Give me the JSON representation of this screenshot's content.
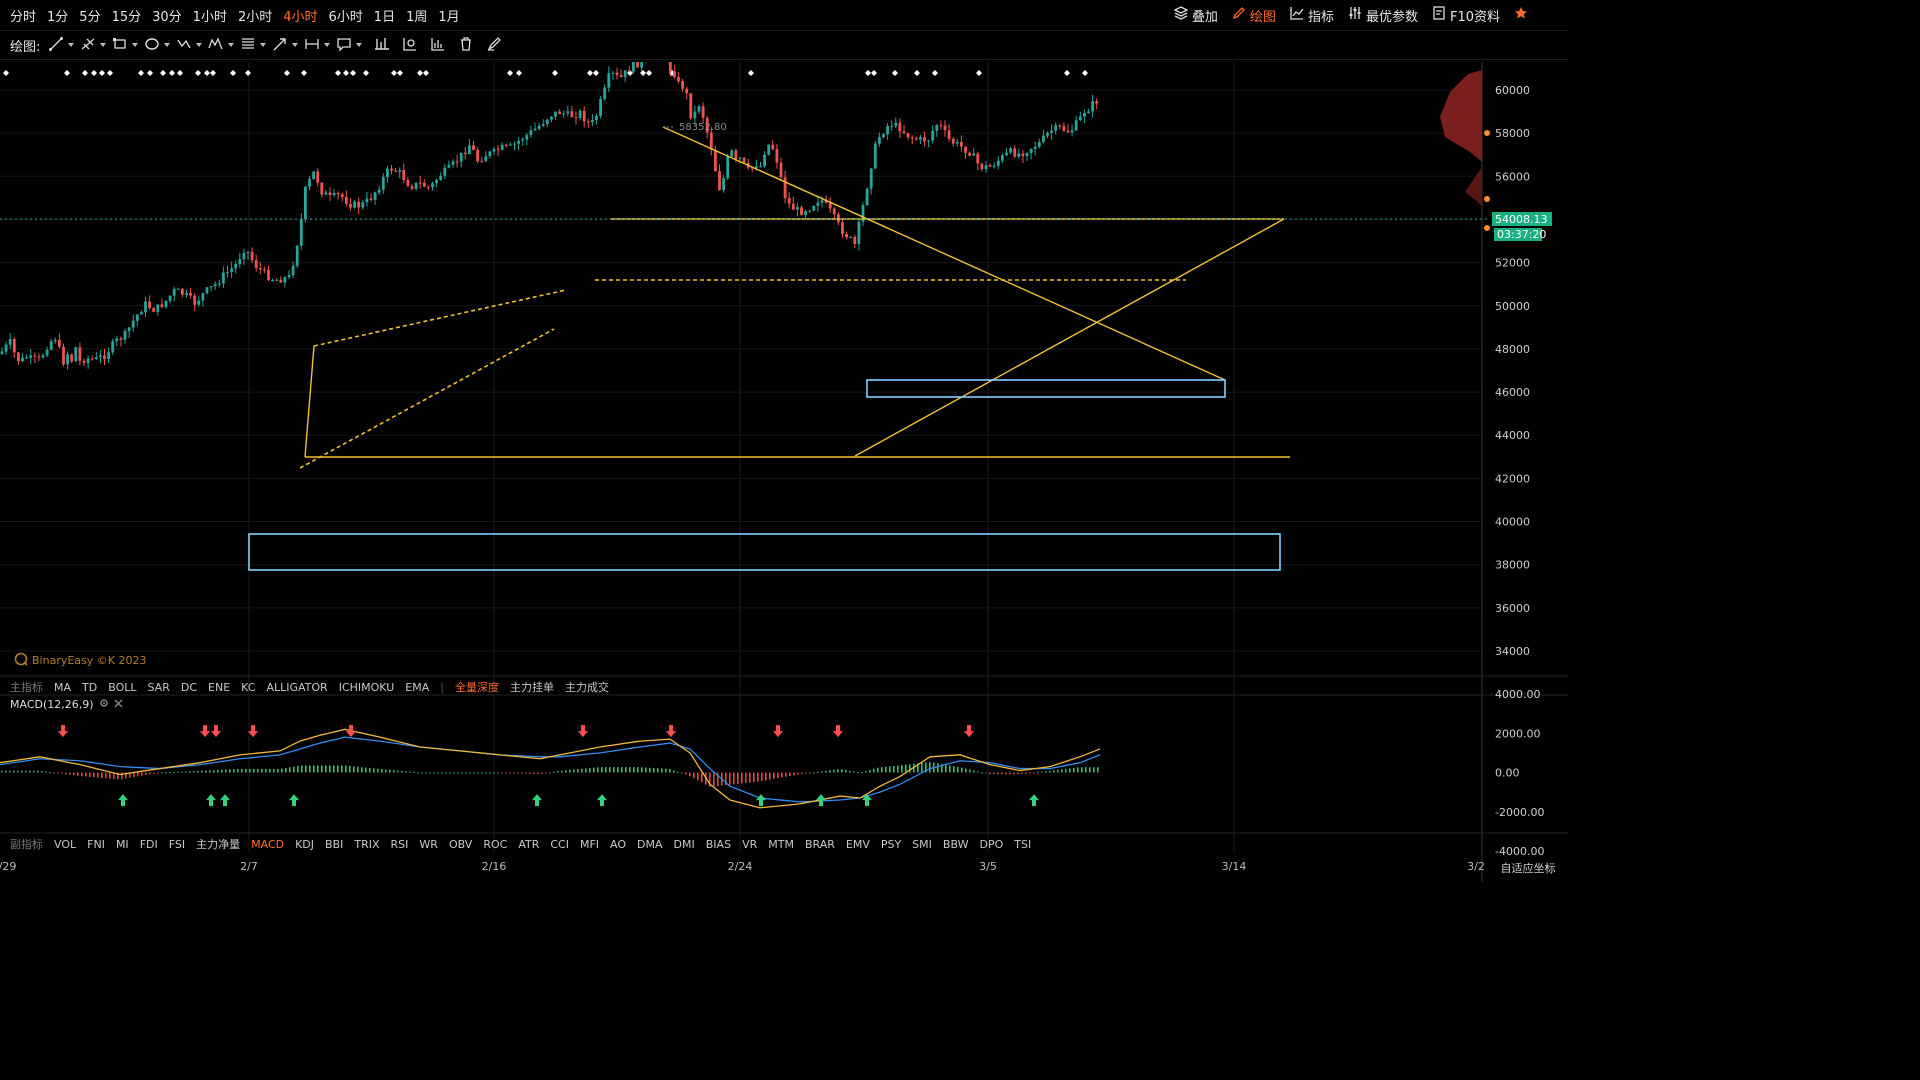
{
  "toolbar": {
    "timeframes": [
      "分时",
      "1分",
      "5分",
      "15分",
      "30分",
      "1小时",
      "2小时",
      "4小时",
      "6小时",
      "1日",
      "1周",
      "1月"
    ],
    "active_timeframe": "4小时",
    "right_items": [
      "叠加",
      "绘图",
      "指标",
      "最优参数",
      "F10资料"
    ],
    "active_right": "绘图"
  },
  "drawing": {
    "label": "绘图:"
  },
  "main_indicators": {
    "label": "主指标",
    "items": [
      "MA",
      "TD",
      "BOLL",
      "SAR",
      "DC",
      "ENE",
      "KC",
      "ALLIGATOR",
      "ICHIMOKU",
      "EMA"
    ],
    "extra": [
      "全量深度",
      "主力挂单",
      "主力成交"
    ],
    "active_extra": "全量深度"
  },
  "sub_indicators": {
    "label": "副指标",
    "items": [
      "VOL",
      "FNI",
      "MI",
      "FDI",
      "FSI",
      "主力净量",
      "MACD",
      "KDJ",
      "BBI",
      "TRIX",
      "RSI",
      "WR",
      "OBV",
      "ROC",
      "ATR",
      "CCI",
      "MFI",
      "AO",
      "DMA",
      "DMI",
      "BIAS",
      "VR",
      "MTM",
      "BRAR",
      "EMV",
      "PSY",
      "SMI",
      "BBW",
      "DPO",
      "TSI"
    ],
    "active": "MACD"
  },
  "watermark": "BinaryEasy ©K 2023",
  "macd": {
    "label": "MACD(12,26,9)"
  },
  "axis_mode": "自适应坐标",
  "chart_data": {
    "type": "candlestick",
    "instrument_price_last": "54008.13",
    "countdown": "03:37:20",
    "high_annotation": "58352.80",
    "y_ticks": [
      "60000",
      "58000",
      "56000",
      "54000",
      "52000",
      "50000",
      "48000",
      "46000",
      "44000",
      "42000",
      "40000",
      "38000",
      "36000",
      "34000"
    ],
    "y_range": [
      32500,
      61300
    ],
    "x_ticks": [
      "1/29",
      "2/7",
      "2/16",
      "2/24",
      "3/5",
      "3/14",
      "3/2"
    ],
    "macd_ticks": [
      "4000.00",
      "2000.00",
      "0.00",
      "-2000.00",
      "-4000.00"
    ],
    "macd_range": [
      -4000,
      4000
    ],
    "close_path": [
      [
        0,
        34600
      ],
      [
        5,
        35200
      ],
      [
        10,
        35800
      ],
      [
        15,
        34500
      ],
      [
        20,
        33800
      ],
      [
        26,
        34300
      ],
      [
        30,
        34100
      ],
      [
        40,
        34000
      ],
      [
        48,
        35600
      ],
      [
        55,
        36300
      ],
      [
        60,
        34800
      ],
      [
        63,
        33700
      ],
      [
        67,
        35000
      ],
      [
        70,
        33200
      ],
      [
        75,
        35500
      ],
      [
        80,
        33800
      ],
      [
        86,
        34200
      ],
      [
        95,
        34000
      ],
      [
        105,
        34500
      ],
      [
        115,
        35800
      ],
      [
        125,
        36500
      ],
      [
        135,
        38200
      ],
      [
        145,
        39600
      ],
      [
        155,
        39000
      ],
      [
        165,
        39800
      ],
      [
        175,
        41000
      ],
      [
        185,
        40500
      ],
      [
        195,
        39700
      ],
      [
        205,
        40800
      ],
      [
        215,
        41500
      ],
      [
        225,
        42600
      ],
      [
        235,
        43400
      ],
      [
        245,
        45300
      ],
      [
        255,
        43500
      ],
      [
        265,
        42600
      ],
      [
        275,
        42000
      ],
      [
        290,
        42300
      ],
      [
        300,
        47000
      ],
      [
        305,
        50900
      ],
      [
        310,
        52000
      ],
      [
        315,
        53000
      ],
      [
        320,
        51000
      ],
      [
        330,
        50200
      ],
      [
        340,
        50500
      ],
      [
        350,
        49600
      ],
      [
        360,
        49400
      ],
      [
        370,
        50100
      ],
      [
        380,
        51500
      ],
      [
        385,
        52500
      ],
      [
        390,
        53200
      ],
      [
        400,
        52700
      ],
      [
        410,
        51400
      ],
      [
        420,
        51600
      ],
      [
        430,
        51200
      ],
      [
        440,
        52500
      ],
      [
        450,
        53200
      ],
      [
        460,
        54300
      ],
      [
        470,
        55600
      ],
      [
        478,
        53900
      ],
      [
        485,
        54500
      ],
      [
        495,
        54800
      ],
      [
        500,
        55200
      ],
      [
        510,
        55200
      ],
      [
        520,
        56000
      ],
      [
        530,
        56700
      ],
      [
        540,
        57500
      ],
      [
        550,
        58500
      ],
      [
        560,
        58800
      ],
      [
        570,
        58400
      ],
      [
        580,
        58700
      ],
      [
        590,
        57500
      ],
      [
        595,
        58000
      ],
      [
        600,
        59600
      ],
      [
        605,
        61000
      ],
      [
        610,
        62700
      ],
      [
        620,
        62100
      ],
      [
        630,
        63200
      ],
      [
        640,
        63800
      ],
      [
        650,
        64200
      ],
      [
        655,
        65000
      ],
      [
        660,
        65300
      ],
      [
        665,
        65000
      ],
      [
        670,
        63100
      ],
      [
        675,
        62600
      ],
      [
        680,
        61200
      ],
      [
        685,
        61500
      ],
      [
        690,
        58500
      ],
      [
        695,
        58700
      ],
      [
        700,
        59800
      ],
      [
        705,
        57500
      ],
      [
        710,
        55900
      ],
      [
        715,
        53200
      ],
      [
        720,
        51000
      ],
      [
        725,
        52600
      ],
      [
        730,
        55300
      ],
      [
        735,
        53800
      ],
      [
        740,
        54100
      ],
      [
        745,
        53300
      ],
      [
        750,
        52700
      ],
      [
        755,
        53800
      ],
      [
        760,
        53200
      ],
      [
        765,
        55000
      ],
      [
        770,
        55700
      ],
      [
        775,
        54800
      ],
      [
        780,
        52600
      ],
      [
        785,
        50400
      ],
      [
        790,
        49400
      ],
      [
        800,
        48800
      ],
      [
        810,
        49300
      ],
      [
        820,
        50200
      ],
      [
        830,
        48900
      ],
      [
        840,
        47200
      ],
      [
        850,
        46100
      ],
      [
        855,
        45500
      ],
      [
        860,
        48000
      ],
      [
        865,
        50300
      ],
      [
        870,
        53000
      ],
      [
        875,
        55200
      ],
      [
        880,
        56500
      ],
      [
        890,
        57700
      ],
      [
        900,
        57200
      ],
      [
        910,
        56300
      ],
      [
        920,
        56000
      ],
      [
        930,
        56100
      ],
      [
        935,
        57600
      ],
      [
        940,
        57400
      ],
      [
        950,
        55900
      ],
      [
        960,
        55400
      ],
      [
        970,
        54800
      ],
      [
        980,
        53300
      ],
      [
        990,
        53300
      ],
      [
        1000,
        54100
      ],
      [
        1010,
        54800
      ],
      [
        1020,
        54600
      ],
      [
        1030,
        55200
      ],
      [
        1040,
        55700
      ],
      [
        1050,
        56900
      ],
      [
        1060,
        57200
      ],
      [
        1070,
        56800
      ],
      [
        1080,
        58100
      ],
      [
        1085,
        59000
      ],
      [
        1090,
        59200
      ],
      [
        1095,
        59900
      ]
    ],
    "macd_points": [
      [
        0,
        500
      ],
      [
        40,
        800
      ],
      [
        80,
        400
      ],
      [
        120,
        -100
      ],
      [
        160,
        200
      ],
      [
        200,
        500
      ],
      [
        240,
        900
      ],
      [
        280,
        1100
      ],
      [
        300,
        1600
      ],
      [
        320,
        1900
      ],
      [
        345,
        2200
      ],
      [
        380,
        1800
      ],
      [
        420,
        1300
      ],
      [
        460,
        1100
      ],
      [
        500,
        900
      ],
      [
        540,
        700
      ],
      [
        560,
        900
      ],
      [
        600,
        1300
      ],
      [
        640,
        1600
      ],
      [
        670,
        1700
      ],
      [
        690,
        1000
      ],
      [
        710,
        -600
      ],
      [
        730,
        -1400
      ],
      [
        760,
        -1800
      ],
      [
        800,
        -1600
      ],
      [
        840,
        -1200
      ],
      [
        860,
        -1300
      ],
      [
        880,
        -700
      ],
      [
        900,
        -200
      ],
      [
        930,
        800
      ],
      [
        960,
        900
      ],
      [
        990,
        400
      ],
      [
        1020,
        100
      ],
      [
        1050,
        300
      ],
      [
        1080,
        800
      ],
      [
        1100,
        1200
      ]
    ],
    "signal_points": [
      [
        0,
        400
      ],
      [
        40,
        700
      ],
      [
        80,
        600
      ],
      [
        120,
        300
      ],
      [
        160,
        200
      ],
      [
        200,
        400
      ],
      [
        240,
        700
      ],
      [
        280,
        900
      ],
      [
        300,
        1200
      ],
      [
        320,
        1500
      ],
      [
        345,
        1800
      ],
      [
        380,
        1600
      ],
      [
        420,
        1300
      ],
      [
        460,
        1100
      ],
      [
        500,
        900
      ],
      [
        540,
        800
      ],
      [
        560,
        800
      ],
      [
        600,
        1000
      ],
      [
        640,
        1300
      ],
      [
        670,
        1500
      ],
      [
        690,
        1200
      ],
      [
        710,
        200
      ],
      [
        730,
        -700
      ],
      [
        760,
        -1300
      ],
      [
        800,
        -1500
      ],
      [
        840,
        -1400
      ],
      [
        860,
        -1300
      ],
      [
        880,
        -1000
      ],
      [
        900,
        -600
      ],
      [
        930,
        200
      ],
      [
        960,
        600
      ],
      [
        990,
        500
      ],
      [
        1020,
        200
      ],
      [
        1050,
        200
      ],
      [
        1080,
        500
      ],
      [
        1100,
        900
      ]
    ],
    "sell_signals_x": [
      63,
      205,
      216,
      253,
      351,
      583,
      671,
      778,
      838,
      969
    ],
    "buy_signals_x": [
      123,
      211,
      225,
      294,
      537,
      602,
      761,
      821,
      867,
      1034
    ]
  }
}
